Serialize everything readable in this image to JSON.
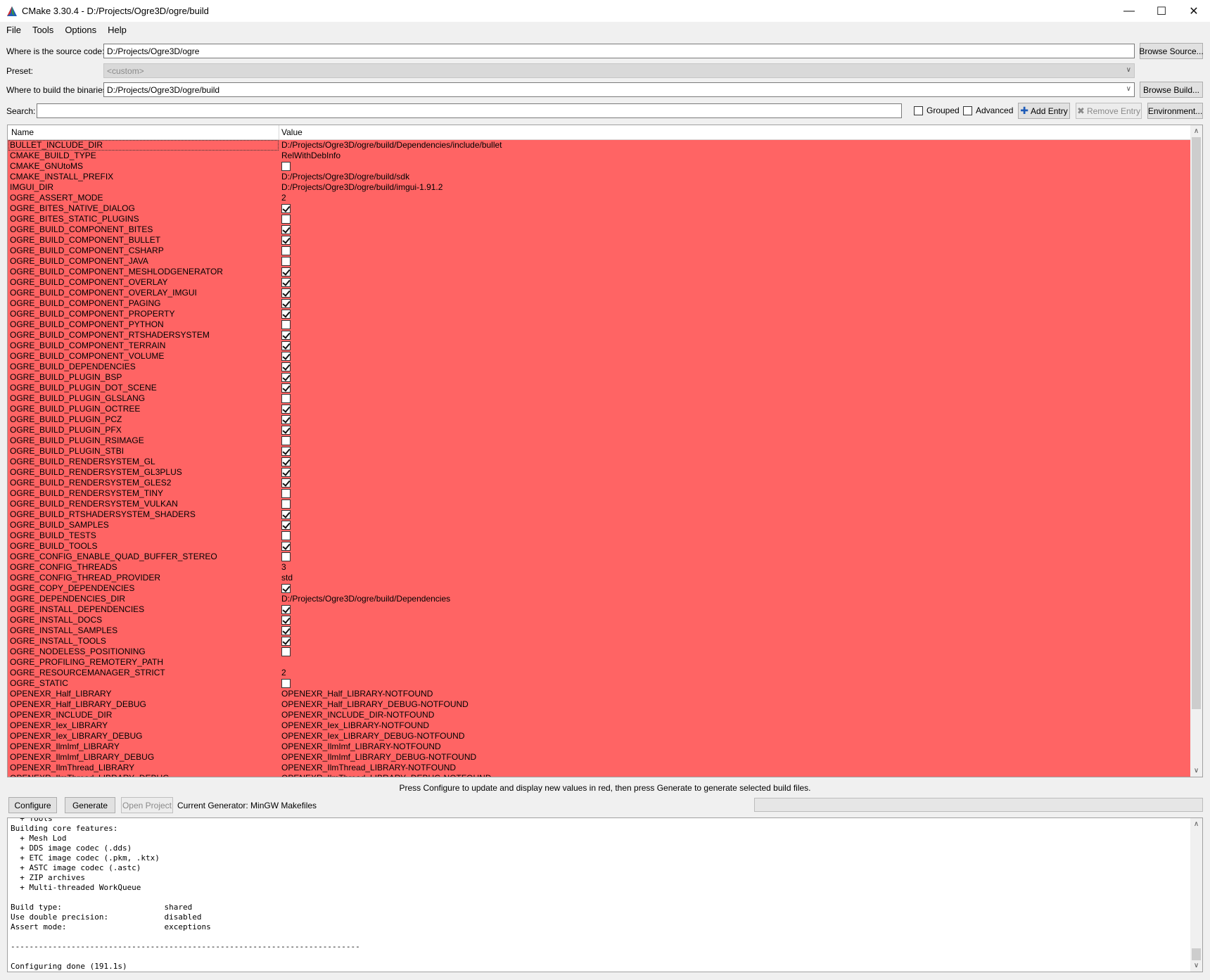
{
  "window": {
    "title": "CMake 3.30.4 - D:/Projects/Ogre3D/ogre/build",
    "minimize": "—",
    "maximize": "☐",
    "close": "✕"
  },
  "menu": [
    "File",
    "Tools",
    "Options",
    "Help"
  ],
  "source": {
    "label": "Where is the source code:",
    "value": "D:/Projects/Ogre3D/ogre",
    "browse": "Browse Source..."
  },
  "preset": {
    "label": "Preset:",
    "value": "<custom>"
  },
  "binaries": {
    "label": "Where to build the binaries:",
    "value": "D:/Projects/Ogre3D/ogre/build",
    "browse": "Browse Build..."
  },
  "search": {
    "label": "Search:",
    "value": ""
  },
  "options": {
    "grouped": {
      "label": "Grouped",
      "checked": false
    },
    "advanced": {
      "label": "Advanced",
      "checked": false
    },
    "add_entry": "Add Entry",
    "remove_entry": "Remove Entry",
    "environment": "Environment..."
  },
  "table": {
    "headers": [
      "Name",
      "Value"
    ],
    "row_color": "#ff6464",
    "rows": [
      {
        "name": "BULLET_INCLUDE_DIR",
        "type": "text",
        "value": "D:/Projects/Ogre3D/ogre/build/Dependencies/include/bullet"
      },
      {
        "name": "CMAKE_BUILD_TYPE",
        "type": "text",
        "value": "RelWithDebInfo"
      },
      {
        "name": "CMAKE_GNUtoMS",
        "type": "bool",
        "value": false
      },
      {
        "name": "CMAKE_INSTALL_PREFIX",
        "type": "text",
        "value": "D:/Projects/Ogre3D/ogre/build/sdk"
      },
      {
        "name": "IMGUI_DIR",
        "type": "text",
        "value": "D:/Projects/Ogre3D/ogre/build/imgui-1.91.2"
      },
      {
        "name": "OGRE_ASSERT_MODE",
        "type": "text",
        "value": "2"
      },
      {
        "name": "OGRE_BITES_NATIVE_DIALOG",
        "type": "bool",
        "value": true
      },
      {
        "name": "OGRE_BITES_STATIC_PLUGINS",
        "type": "bool",
        "value": false
      },
      {
        "name": "OGRE_BUILD_COMPONENT_BITES",
        "type": "bool",
        "value": true
      },
      {
        "name": "OGRE_BUILD_COMPONENT_BULLET",
        "type": "bool",
        "value": true
      },
      {
        "name": "OGRE_BUILD_COMPONENT_CSHARP",
        "type": "bool",
        "value": false
      },
      {
        "name": "OGRE_BUILD_COMPONENT_JAVA",
        "type": "bool",
        "value": false
      },
      {
        "name": "OGRE_BUILD_COMPONENT_MESHLODGENERATOR",
        "type": "bool",
        "value": true
      },
      {
        "name": "OGRE_BUILD_COMPONENT_OVERLAY",
        "type": "bool",
        "value": true
      },
      {
        "name": "OGRE_BUILD_COMPONENT_OVERLAY_IMGUI",
        "type": "bool",
        "value": true
      },
      {
        "name": "OGRE_BUILD_COMPONENT_PAGING",
        "type": "bool",
        "value": true
      },
      {
        "name": "OGRE_BUILD_COMPONENT_PROPERTY",
        "type": "bool",
        "value": true
      },
      {
        "name": "OGRE_BUILD_COMPONENT_PYTHON",
        "type": "bool",
        "value": false
      },
      {
        "name": "OGRE_BUILD_COMPONENT_RTSHADERSYSTEM",
        "type": "bool",
        "value": true
      },
      {
        "name": "OGRE_BUILD_COMPONENT_TERRAIN",
        "type": "bool",
        "value": true
      },
      {
        "name": "OGRE_BUILD_COMPONENT_VOLUME",
        "type": "bool",
        "value": true
      },
      {
        "name": "OGRE_BUILD_DEPENDENCIES",
        "type": "bool",
        "value": true
      },
      {
        "name": "OGRE_BUILD_PLUGIN_BSP",
        "type": "bool",
        "value": true
      },
      {
        "name": "OGRE_BUILD_PLUGIN_DOT_SCENE",
        "type": "bool",
        "value": true
      },
      {
        "name": "OGRE_BUILD_PLUGIN_GLSLANG",
        "type": "bool",
        "value": false
      },
      {
        "name": "OGRE_BUILD_PLUGIN_OCTREE",
        "type": "bool",
        "value": true
      },
      {
        "name": "OGRE_BUILD_PLUGIN_PCZ",
        "type": "bool",
        "value": true
      },
      {
        "name": "OGRE_BUILD_PLUGIN_PFX",
        "type": "bool",
        "value": true
      },
      {
        "name": "OGRE_BUILD_PLUGIN_RSIMAGE",
        "type": "bool",
        "value": false
      },
      {
        "name": "OGRE_BUILD_PLUGIN_STBI",
        "type": "bool",
        "value": true
      },
      {
        "name": "OGRE_BUILD_RENDERSYSTEM_GL",
        "type": "bool",
        "value": true
      },
      {
        "name": "OGRE_BUILD_RENDERSYSTEM_GL3PLUS",
        "type": "bool",
        "value": true
      },
      {
        "name": "OGRE_BUILD_RENDERSYSTEM_GLES2",
        "type": "bool",
        "value": true
      },
      {
        "name": "OGRE_BUILD_RENDERSYSTEM_TINY",
        "type": "bool",
        "value": false
      },
      {
        "name": "OGRE_BUILD_RENDERSYSTEM_VULKAN",
        "type": "bool",
        "value": false
      },
      {
        "name": "OGRE_BUILD_RTSHADERSYSTEM_SHADERS",
        "type": "bool",
        "value": true
      },
      {
        "name": "OGRE_BUILD_SAMPLES",
        "type": "bool",
        "value": true
      },
      {
        "name": "OGRE_BUILD_TESTS",
        "type": "bool",
        "value": false
      },
      {
        "name": "OGRE_BUILD_TOOLS",
        "type": "bool",
        "value": true
      },
      {
        "name": "OGRE_CONFIG_ENABLE_QUAD_BUFFER_STEREO",
        "type": "bool",
        "value": false
      },
      {
        "name": "OGRE_CONFIG_THREADS",
        "type": "text",
        "value": "3"
      },
      {
        "name": "OGRE_CONFIG_THREAD_PROVIDER",
        "type": "text",
        "value": "std"
      },
      {
        "name": "OGRE_COPY_DEPENDENCIES",
        "type": "bool",
        "value": true
      },
      {
        "name": "OGRE_DEPENDENCIES_DIR",
        "type": "text",
        "value": "D:/Projects/Ogre3D/ogre/build/Dependencies"
      },
      {
        "name": "OGRE_INSTALL_DEPENDENCIES",
        "type": "bool",
        "value": true
      },
      {
        "name": "OGRE_INSTALL_DOCS",
        "type": "bool",
        "value": true
      },
      {
        "name": "OGRE_INSTALL_SAMPLES",
        "type": "bool",
        "value": true
      },
      {
        "name": "OGRE_INSTALL_TOOLS",
        "type": "bool",
        "value": true
      },
      {
        "name": "OGRE_NODELESS_POSITIONING",
        "type": "bool",
        "value": false
      },
      {
        "name": "OGRE_PROFILING_REMOTERY_PATH",
        "type": "text",
        "value": ""
      },
      {
        "name": "OGRE_RESOURCEMANAGER_STRICT",
        "type": "text",
        "value": "2"
      },
      {
        "name": "OGRE_STATIC",
        "type": "bool",
        "value": false
      },
      {
        "name": "OPENEXR_Half_LIBRARY",
        "type": "text",
        "value": "OPENEXR_Half_LIBRARY-NOTFOUND"
      },
      {
        "name": "OPENEXR_Half_LIBRARY_DEBUG",
        "type": "text",
        "value": "OPENEXR_Half_LIBRARY_DEBUG-NOTFOUND"
      },
      {
        "name": "OPENEXR_INCLUDE_DIR",
        "type": "text",
        "value": "OPENEXR_INCLUDE_DIR-NOTFOUND"
      },
      {
        "name": "OPENEXR_Iex_LIBRARY",
        "type": "text",
        "value": "OPENEXR_Iex_LIBRARY-NOTFOUND"
      },
      {
        "name": "OPENEXR_Iex_LIBRARY_DEBUG",
        "type": "text",
        "value": "OPENEXR_Iex_LIBRARY_DEBUG-NOTFOUND"
      },
      {
        "name": "OPENEXR_IlmImf_LIBRARY",
        "type": "text",
        "value": "OPENEXR_IlmImf_LIBRARY-NOTFOUND"
      },
      {
        "name": "OPENEXR_IlmImf_LIBRARY_DEBUG",
        "type": "text",
        "value": "OPENEXR_IlmImf_LIBRARY_DEBUG-NOTFOUND"
      },
      {
        "name": "OPENEXR_IlmThread_LIBRARY",
        "type": "text",
        "value": "OPENEXR_IlmThread_LIBRARY-NOTFOUND"
      },
      {
        "name": "OPENEXR_IlmThread_LIBRARY_DEBUG",
        "type": "text",
        "value": "OPENEXR_IlmThread_LIBRARY_DEBUG-NOTFOUND"
      }
    ]
  },
  "hint": "Press Configure to update and display new values in red, then press Generate to generate selected build files.",
  "actions": {
    "configure": "Configure",
    "generate": "Generate",
    "open_project": "Open Project",
    "generator": "Current Generator: MinGW Makefiles"
  },
  "log": "  + Tools\nBuilding core features:\n  + Mesh Lod\n  + DDS image codec (.dds)\n  + ETC image codec (.pkm, .ktx)\n  + ASTC image codec (.astc)\n  + ZIP archives\n  + Multi-threaded WorkQueue\n\nBuild type:                      shared\nUse double precision:            disabled\nAssert mode:                     exceptions\n\n---------------------------------------------------------------------------\n\nConfiguring done (191.1s)"
}
